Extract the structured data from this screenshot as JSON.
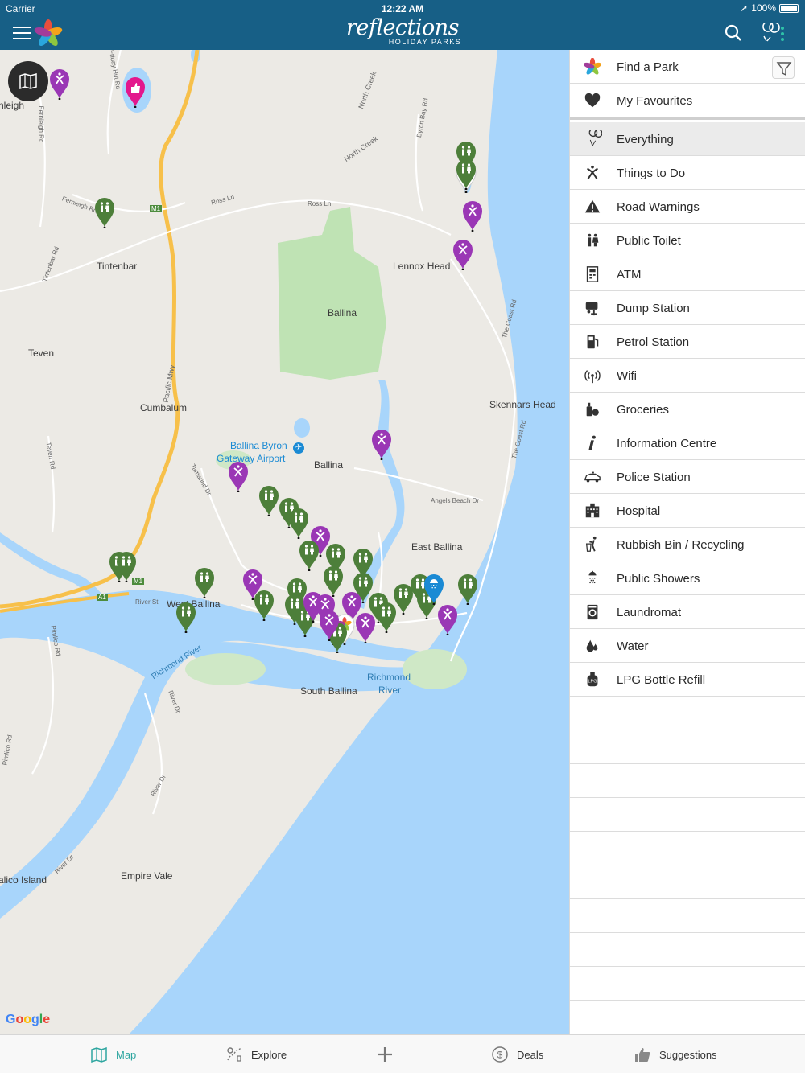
{
  "status": {
    "carrier": "Carrier",
    "time": "12:22 AM",
    "battery": "100%"
  },
  "header": {
    "brand": "reflections",
    "brand_sub": "HOLIDAY PARKS"
  },
  "map": {
    "labels": {
      "leigh": "nleigh",
      "tintenbar": "Tintenbar",
      "teven": "Teven",
      "cumbalum": "Cumbalum",
      "ballina_park": "Ballina",
      "lennox_head": "Lennox Head",
      "skennars_head": "Skennars Head",
      "airport1": "Ballina Byron",
      "airport2": "Gateway Airport",
      "ballina": "Ballina",
      "east_ballina": "East Ballina",
      "west_ballina": "West Ballina",
      "south_ballina": "South Ballina",
      "richmond_river1": "Richmond",
      "richmond_river2": "River",
      "empire_vale": "Empire Vale",
      "island": "alico Island",
      "richmond_river_label": "Richmond River",
      "pacific_mwy": "Pacific Mwy",
      "ross_ln": "Ross Ln",
      "ross_ln2": "Ross Ln",
      "north_creek": "North Creek",
      "north_creek2": "North Creek",
      "m1": "M1",
      "m1b": "M1",
      "a1": "A1",
      "coast_rd": "The Coast Rd",
      "coast_rd2": "The Coast Rd",
      "angels_beach": "Angels Beach Dr",
      "river_st": "River St",
      "river_dr": "River Dr",
      "river_dr2": "River Dr",
      "fernleigh": "Fernleigh Rd",
      "tintenbar_rd": "Tintenbar Rd",
      "byron_bay_rd": "Byron Bay Rd",
      "friday_hut": "Friday Hut Rd",
      "teven_rd": "Teven Rd",
      "pimlico": "Pimlico Rd",
      "pimlico2": "Pimlico Rd",
      "tamarind": "Tamarind Dr",
      "river_dr3": "River Dr",
      "google": [
        "G",
        "o",
        "o",
        "g",
        "l",
        "e"
      ]
    }
  },
  "panel": {
    "find_park": "Find a Park",
    "favourites": "My Favourites",
    "categories": [
      {
        "label": "Everything",
        "icon": "balloon-icon"
      },
      {
        "label": "Things to Do",
        "icon": "activity-icon"
      },
      {
        "label": "Road Warnings",
        "icon": "warning-icon"
      },
      {
        "label": "Public Toilet",
        "icon": "toilet-icon"
      },
      {
        "label": "ATM",
        "icon": "atm-icon"
      },
      {
        "label": "Dump Station",
        "icon": "dump-station-icon"
      },
      {
        "label": "Petrol Station",
        "icon": "petrol-icon"
      },
      {
        "label": "Wifi",
        "icon": "wifi-icon"
      },
      {
        "label": "Groceries",
        "icon": "groceries-icon"
      },
      {
        "label": "Information Centre",
        "icon": "info-icon"
      },
      {
        "label": "Police Station",
        "icon": "police-car-icon"
      },
      {
        "label": "Hospital",
        "icon": "hospital-icon"
      },
      {
        "label": "Rubbish Bin / Recycling",
        "icon": "bin-icon"
      },
      {
        "label": "Public Showers",
        "icon": "shower-icon"
      },
      {
        "label": "Laundromat",
        "icon": "washer-icon"
      },
      {
        "label": "Water",
        "icon": "water-drop-icon"
      },
      {
        "label": "LPG Bottle Refill",
        "icon": "lpg-icon"
      }
    ]
  },
  "tabs": {
    "map": "Map",
    "explore": "Explore",
    "deals": "Deals",
    "suggestions": "Suggestions"
  },
  "colors": {
    "header": "#175f86",
    "accent": "#2ea6a0",
    "toilet_pin": "#4d7f3a",
    "activity_pin": "#9a37b5",
    "water": "#a8d5fb"
  }
}
